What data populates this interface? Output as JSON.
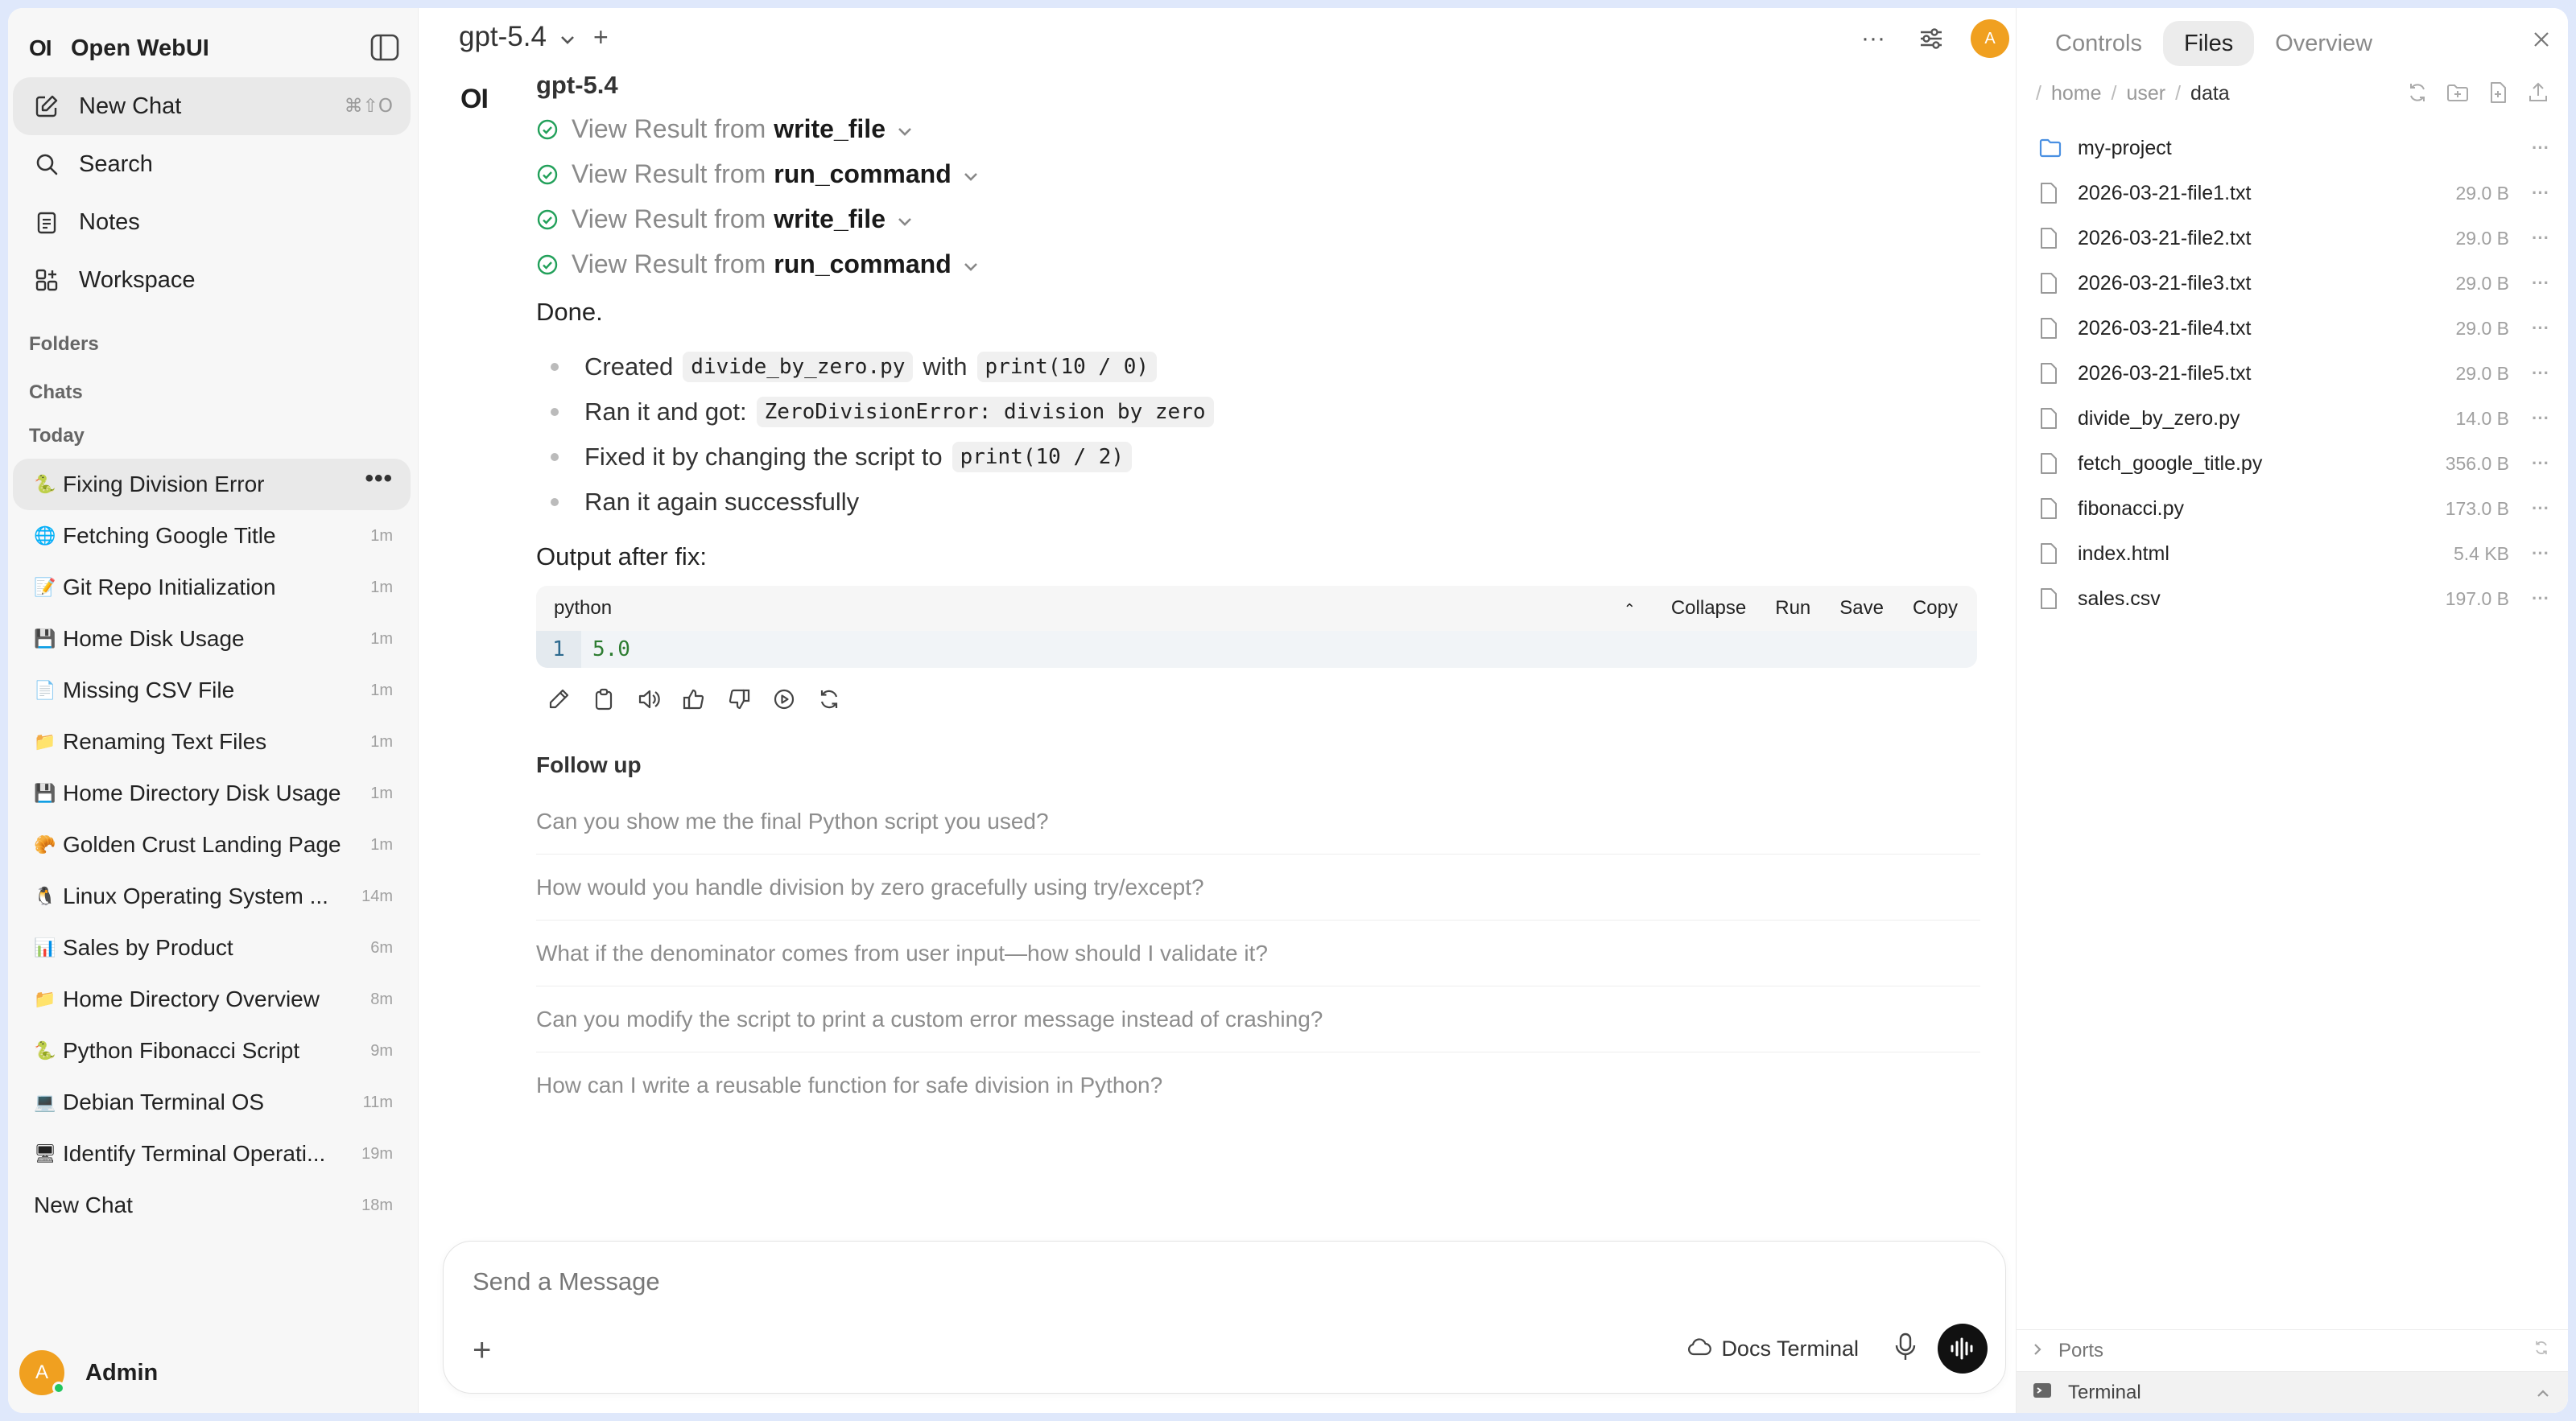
{
  "sidebar": {
    "logo": "OI",
    "app_name": "Open WebUI",
    "nav": [
      {
        "label": "New Chat",
        "shortcut": "⌘⇧O"
      },
      {
        "label": "Search"
      },
      {
        "label": "Notes"
      },
      {
        "label": "Workspace"
      }
    ],
    "folders_label": "Folders",
    "chats_label": "Chats",
    "today_label": "Today",
    "chats": [
      {
        "emoji": "🐍",
        "title": "Fixing Division Error",
        "age": ""
      },
      {
        "emoji": "🌐",
        "title": "Fetching Google Title",
        "age": "1m"
      },
      {
        "emoji": "📝",
        "title": "Git Repo Initialization",
        "age": "1m"
      },
      {
        "emoji": "💾",
        "title": "Home Disk Usage",
        "age": "1m"
      },
      {
        "emoji": "📄",
        "title": "Missing CSV File",
        "age": "1m"
      },
      {
        "emoji": "📁",
        "title": "Renaming Text Files",
        "age": "1m"
      },
      {
        "emoji": "💾",
        "title": "Home Directory Disk Usage",
        "age": "1m"
      },
      {
        "emoji": "🥐",
        "title": "Golden Crust Landing Page",
        "age": "1m"
      },
      {
        "emoji": "🐧",
        "title": "Linux Operating System ...",
        "age": "14m"
      },
      {
        "emoji": "📊",
        "title": "Sales by Product",
        "age": "6m"
      },
      {
        "emoji": "📁",
        "title": "Home Directory Overview",
        "age": "8m"
      },
      {
        "emoji": "🐍",
        "title": "Python Fibonacci Script",
        "age": "9m"
      },
      {
        "emoji": "💻",
        "title": "Debian Terminal OS",
        "age": "11m"
      },
      {
        "emoji": "🖥",
        "title": "Identify Terminal Operati...",
        "age": "19m"
      },
      {
        "emoji": "",
        "title": "New Chat",
        "age": "18m"
      }
    ],
    "more_glyph": "•••",
    "user": {
      "initial": "A",
      "name": "Admin"
    }
  },
  "topbar": {
    "model": "gpt-5.4",
    "plus": "+",
    "more_glyph": "···",
    "avatar_initial": "A"
  },
  "message": {
    "logo": "OI",
    "model_name": "gpt-5.4",
    "tools": [
      {
        "prefix": "View Result from",
        "name": "write_file"
      },
      {
        "prefix": "View Result from",
        "name": "run_command"
      },
      {
        "prefix": "View Result from",
        "name": "write_file"
      },
      {
        "prefix": "View Result from",
        "name": "run_command"
      }
    ],
    "done": "Done.",
    "bullets": {
      "b1_pre": "Created",
      "b1_code1": "divide_by_zero.py",
      "b1_mid": "with",
      "b1_code2": "print(10 / 0)",
      "b2_pre": "Ran it and got:",
      "b2_code": "ZeroDivisionError: division by zero",
      "b3_pre": "Fixed it by changing the script to",
      "b3_code": "print(10 / 2)",
      "b4": "Ran it again successfully"
    },
    "output_label": "Output after fix:",
    "code": {
      "lang": "python",
      "collapse": "Collapse",
      "run": "Run",
      "save": "Save",
      "copy": "Copy",
      "line_no": "1",
      "line": "5.0"
    },
    "followup_title": "Follow up",
    "followups": [
      "Can you show me the final Python script you used?",
      "How would you handle division by zero gracefully using try/except?",
      "What if the denominator comes from user input—how should I validate it?",
      "Can you modify the script to print a custom error message instead of crashing?",
      "How can I write a reusable function for safe division in Python?"
    ]
  },
  "composer": {
    "placeholder": "Send a Message",
    "plus": "+",
    "docs_label": "Docs Terminal"
  },
  "panel": {
    "tabs": [
      "Controls",
      "Files",
      "Overview"
    ],
    "crumbs": [
      "home",
      "user",
      "data"
    ],
    "crumb_sep": "/",
    "files": [
      {
        "name": "my-project",
        "size": "",
        "type": "folder"
      },
      {
        "name": "2026-03-21-file1.txt",
        "size": "29.0 B",
        "type": "file"
      },
      {
        "name": "2026-03-21-file2.txt",
        "size": "29.0 B",
        "type": "file"
      },
      {
        "name": "2026-03-21-file3.txt",
        "size": "29.0 B",
        "type": "file"
      },
      {
        "name": "2026-03-21-file4.txt",
        "size": "29.0 B",
        "type": "file"
      },
      {
        "name": "2026-03-21-file5.txt",
        "size": "29.0 B",
        "type": "file"
      },
      {
        "name": "divide_by_zero.py",
        "size": "14.0 B",
        "type": "file"
      },
      {
        "name": "fetch_google_title.py",
        "size": "356.0 B",
        "type": "file"
      },
      {
        "name": "fibonacci.py",
        "size": "173.0 B",
        "type": "file"
      },
      {
        "name": "index.html",
        "size": "5.4 KB",
        "type": "file"
      },
      {
        "name": "sales.csv",
        "size": "197.0 B",
        "type": "file"
      }
    ],
    "file_more": "···",
    "ports_label": "Ports",
    "terminal_label": "Terminal"
  },
  "colors": {
    "accent_avatar": "#f0a020",
    "success_check": "#22a05a",
    "folder_icon": "#4a90e2"
  }
}
